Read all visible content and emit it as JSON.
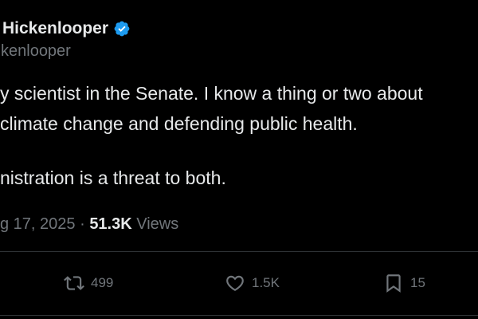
{
  "author": {
    "name_visible": "Hickenlooper",
    "handle_visible": "kenlooper",
    "verified_color": "#1d9bf0"
  },
  "tweet": {
    "lines": [
      "y scientist in the Senate. I know a thing or two about",
      " climate change and defending public health.",
      "nistration is a threat to both."
    ]
  },
  "meta": {
    "date": "g 17, 2025",
    "separator": " · ",
    "views_count": "51.3K",
    "views_label": " Views"
  },
  "actions": {
    "retweets": "499",
    "likes": "1.5K",
    "bookmarks": "15",
    "icon_color": "#71767b"
  },
  "colors": {
    "background": "#000000",
    "text": "#e7e9ea",
    "secondary": "#71767b",
    "divider": "#2f3336"
  }
}
